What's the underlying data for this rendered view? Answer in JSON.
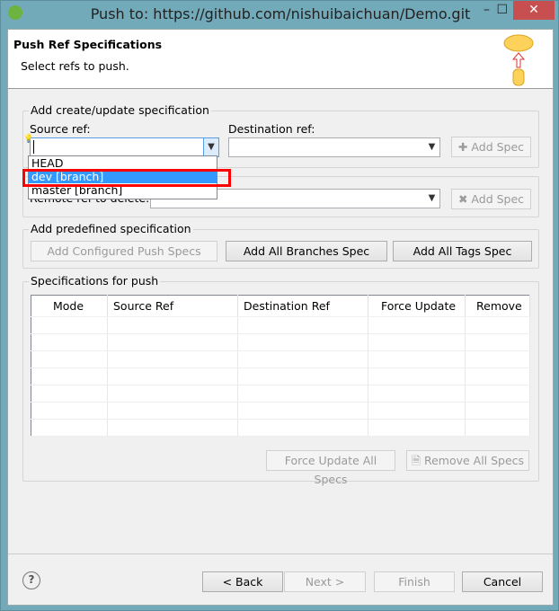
{
  "window": {
    "title": "Push to: https://github.com/nishuibaichuan/Demo.git",
    "minimize": "–",
    "maximize": "☐",
    "close": "✕"
  },
  "header": {
    "title": "Push Ref Specifications",
    "subtitle": "Select refs to push."
  },
  "create_group": {
    "label": "Add create/update specification",
    "source_label": "Source ref:",
    "dest_label": "Destination ref:",
    "source_value": "",
    "dest_value": "",
    "add_spec": "Add Spec"
  },
  "dropdown": {
    "options": [
      "HEAD",
      "dev [branch]",
      "master [branch]"
    ],
    "selected": "dev [branch]"
  },
  "delete_group": {
    "label": "Remote ref to delete:",
    "value": "",
    "add_spec": "Add Spec"
  },
  "predefined": {
    "label": "Add predefined specification",
    "configured": "Add Configured Push Specs",
    "all_branches": "Add All Branches Spec",
    "all_tags": "Add All Tags Spec"
  },
  "specs": {
    "label": "Specifications for push",
    "columns": [
      "Mode",
      "Source Ref",
      "Destination Ref",
      "Force Update",
      "Remove"
    ],
    "force_all": "Force Update All Specs",
    "remove_all": "Remove All Specs"
  },
  "footer": {
    "help": "?",
    "back": "< Back",
    "next": "Next >",
    "finish": "Finish",
    "cancel": "Cancel"
  }
}
